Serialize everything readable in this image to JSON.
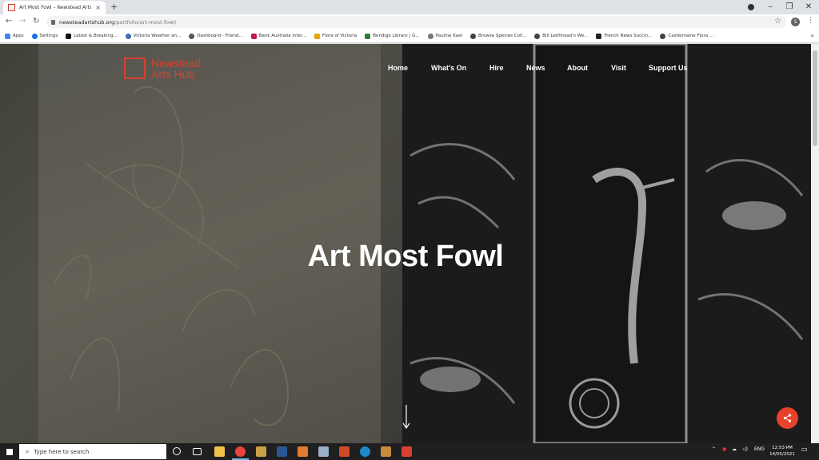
{
  "browser": {
    "tab_title": "Art Most Fowl – Newstead Arts H",
    "tab_close": "×",
    "new_tab": "+",
    "window_controls": [
      "–",
      "❐",
      "✕"
    ],
    "url_host": "newsteadartshub.org",
    "url_path": "/portfolio/art-most-fowl/",
    "profile_initial": "S",
    "bookmarks": [
      "Apps",
      "Settings",
      "Latest & Breaking...",
      "Victoria Weather an...",
      "Dashboard - Friend...",
      "Bank Australia inter...",
      "Flora of Victoria",
      "Bendigo Library | G...",
      "Pauline Kael",
      "Browse Species Coll...",
      "Bill Leithhead's We...",
      "French News Succin...",
      "Castlemaine Flora ..."
    ],
    "bookmarks_more": "»"
  },
  "site": {
    "logo_line1": "Newstead",
    "logo_line2": "Arts Hub.",
    "nav": [
      "Home",
      "What's On",
      "Hire",
      "News",
      "About",
      "Visit",
      "Support Us"
    ],
    "hero_title": "Art Most Fowl"
  },
  "taskbar": {
    "search_placeholder": "Type here to search",
    "time": "12:53 PM",
    "date": "14/05/2021",
    "lang": "ENG"
  },
  "colors": {
    "brand": "#d8412f",
    "share_fab": "#e8412c"
  }
}
